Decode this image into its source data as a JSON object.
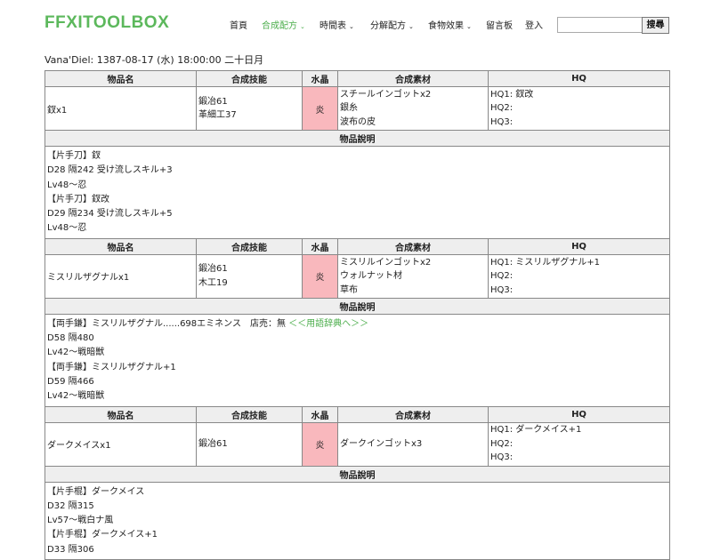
{
  "brand": "FFXITOOLBOX",
  "nav": [
    {
      "label": "首頁"
    },
    {
      "label": "合成配方",
      "caret": "⌄"
    },
    {
      "label": "時間表",
      "caret": "⌄"
    },
    {
      "label": "分解配方",
      "caret": "⌄"
    },
    {
      "label": "食物效果",
      "caret": "⌄"
    },
    {
      "label": "留言板"
    },
    {
      "label": "登入"
    }
  ],
  "search": {
    "value": "",
    "button_label": "搜尋"
  },
  "vana_time": "Vana'Diel: 1387-08-17 (水) 18:00:00 二十日月",
  "headers": {
    "name": "物品名",
    "skill": "合成技能",
    "crystal": "水晶",
    "materials": "合成素材",
    "hq": "HQ",
    "description": "物品說明"
  },
  "recipes": [
    {
      "name": "釵x1",
      "skills": [
        "鍛冶61",
        "革細工37"
      ],
      "crystal": "炎",
      "materials": [
        "スチールインゴットx2",
        "銀糸",
        "波布の皮"
      ],
      "hq": [
        "HQ1: 釵改",
        "HQ2:",
        "HQ3:"
      ],
      "desc": [
        "【片手刀】釵",
        "D28 隔242 受け流しスキル+3",
        "Lv48～忍",
        "【片手刀】釵改",
        "D29 隔234 受け流しスキル+5",
        "Lv48～忍"
      ]
    },
    {
      "name": "ミスリルザグナルx1",
      "skills": [
        "鍛冶61",
        "木工19"
      ],
      "crystal": "炎",
      "materials": [
        "ミスリルインゴットx2",
        "ウォルナット材",
        "草布"
      ],
      "hq": [
        "HQ1: ミスリルザグナル+1",
        "HQ2:",
        "HQ3:"
      ],
      "desc_first": "【両手鎌】ミスリルザグナル......698エミネンス　店売：無",
      "desc_link": "＜＜用語辞典へ＞＞",
      "desc": [
        "D58 隔480",
        "Lv42～戦暗獣",
        "【両手鎌】ミスリルザグナル+1",
        "D59 隔466",
        "Lv42～戦暗獣"
      ]
    },
    {
      "name": "ダークメイスx1",
      "skills": [
        "鍛冶61"
      ],
      "crystal": "炎",
      "materials": [
        "ダークインゴットx3"
      ],
      "hq": [
        "HQ1: ダークメイス+1",
        "HQ2:",
        "HQ3:"
      ],
      "desc": [
        "【片手棍】ダークメイス",
        "D32 隔315",
        "Lv57～戦白ナ風",
        "【片手棍】ダークメイス+1",
        "D33 隔306"
      ]
    }
  ]
}
